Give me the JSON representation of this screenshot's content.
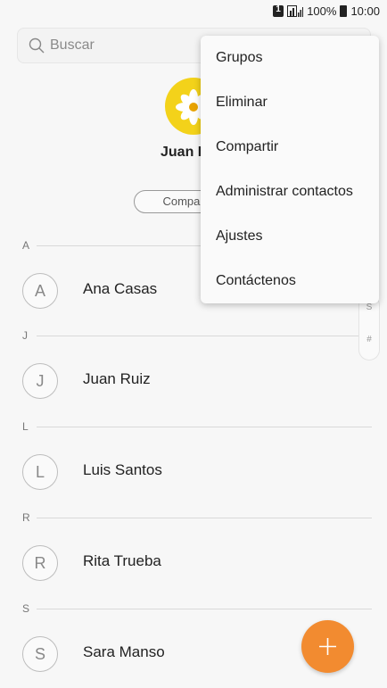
{
  "status_bar": {
    "battery": "100%",
    "time": "10:00"
  },
  "search": {
    "placeholder": "Buscar"
  },
  "profile": {
    "name_visible": "Juan R",
    "share_label": "Compartir"
  },
  "sections": [
    {
      "letter": "A",
      "contacts": [
        {
          "initial": "A",
          "name": "Ana Casas"
        }
      ]
    },
    {
      "letter": "J",
      "contacts": [
        {
          "initial": "J",
          "name": "Juan Ruiz"
        }
      ]
    },
    {
      "letter": "L",
      "contacts": [
        {
          "initial": "L",
          "name": "Luis Santos"
        }
      ]
    },
    {
      "letter": "R",
      "contacts": [
        {
          "initial": "R",
          "name": "Rita Trueba"
        }
      ]
    },
    {
      "letter": "S",
      "contacts": [
        {
          "initial": "S",
          "name": "Sara Manso"
        }
      ]
    }
  ],
  "index_strip": [
    "S",
    "#"
  ],
  "menu": {
    "items": [
      "Grupos",
      "Eliminar",
      "Compartir",
      "Administrar contactos",
      "Ajustes",
      "Contáctenos"
    ]
  },
  "colors": {
    "accent": "#f28b30",
    "avatar_bg": "#f3d21a"
  }
}
